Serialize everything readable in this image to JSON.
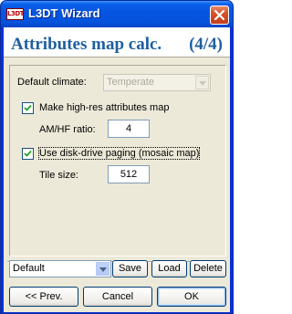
{
  "window": {
    "title": "L3DT Wizard",
    "app_icon_text": "L3DT"
  },
  "header": {
    "title": "Attributes map calc.",
    "step": "(4/4)"
  },
  "form": {
    "default_climate_label": "Default climate:",
    "default_climate_value": "Temperate",
    "hires_checkbox_label": "Make high-res attributes map",
    "hires_checked": true,
    "am_hf_ratio_label": "AM/HF ratio:",
    "am_hf_ratio_value": "4",
    "paging_checkbox_label": "Use disk-drive paging (mosaic map)",
    "paging_checked": true,
    "tile_size_label": "Tile size:",
    "tile_size_value": "512"
  },
  "presets": {
    "selected": "Default",
    "save_label": "Save",
    "load_label": "Load",
    "delete_label": "Delete"
  },
  "nav": {
    "prev_label": "<< Prev.",
    "cancel_label": "Cancel",
    "ok_label": "OK"
  },
  "colors": {
    "title_bar": "#0655e0",
    "header_text": "#1f5f9f",
    "dialog_bg": "#ece9d8",
    "close_button": "#d7502b"
  }
}
